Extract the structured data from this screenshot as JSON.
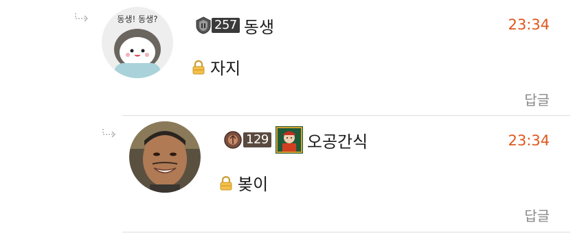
{
  "comments": [
    {
      "level": "257",
      "nickname": "동생",
      "time": "23:34",
      "text": "자지",
      "reply_label": "답글",
      "avatar_text": "동생! 동생?"
    },
    {
      "level": "129",
      "nickname": "오공간식",
      "time": "23:34",
      "text": "봊이",
      "reply_label": "답글"
    }
  ],
  "colors": {
    "time": "#e0561b",
    "reply": "#888888",
    "divider": "#dcdcdc"
  },
  "icons": [
    "reply-arrow-icon",
    "lock-icon",
    "level-badge-icon"
  ]
}
